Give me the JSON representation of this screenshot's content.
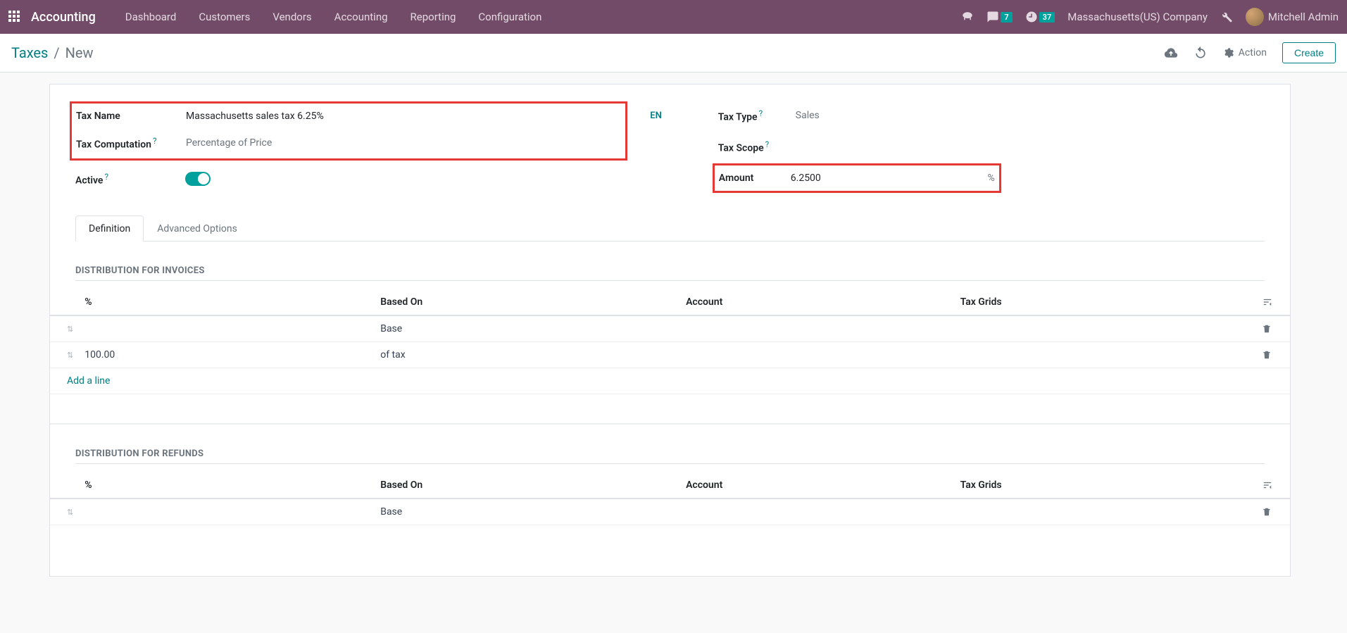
{
  "topbar": {
    "app_title": "Accounting",
    "nav": [
      "Dashboard",
      "Customers",
      "Vendors",
      "Accounting",
      "Reporting",
      "Configuration"
    ],
    "badges": {
      "messages": "7",
      "activities": "37"
    },
    "company": "Massachusetts(US) Company",
    "user": "Mitchell Admin"
  },
  "controlbar": {
    "breadcrumb_root": "Taxes",
    "breadcrumb_current": "New",
    "action_label": "Action",
    "create_label": "Create"
  },
  "form": {
    "tax_name_label": "Tax Name",
    "tax_name_value": "Massachusetts sales tax 6.25%",
    "tax_computation_label": "Tax Computation",
    "tax_computation_value": "Percentage of Price",
    "active_label": "Active",
    "lang_btn": "EN",
    "tax_type_label": "Tax Type",
    "tax_type_value": "Sales",
    "tax_scope_label": "Tax Scope",
    "amount_label": "Amount",
    "amount_value": "6.2500",
    "amount_unit": "%"
  },
  "tabs": {
    "definition": "Definition",
    "advanced": "Advanced Options"
  },
  "distribution_invoices": {
    "title": "Distribution for Invoices",
    "columns": {
      "pct": "%",
      "based_on": "Based On",
      "account": "Account",
      "tax_grids": "Tax Grids"
    },
    "rows": [
      {
        "pct": "",
        "based_on": "Base"
      },
      {
        "pct": "100.00",
        "based_on": "of tax"
      }
    ],
    "add_line": "Add a line"
  },
  "distribution_refunds": {
    "title": "Distribution for Refunds",
    "columns": {
      "pct": "%",
      "based_on": "Based On",
      "account": "Account",
      "tax_grids": "Tax Grids"
    },
    "rows": [
      {
        "pct": "",
        "based_on": "Base"
      }
    ]
  }
}
